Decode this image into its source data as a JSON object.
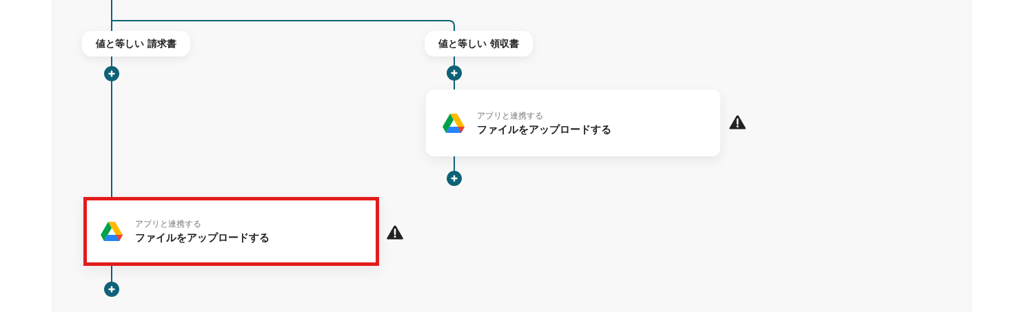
{
  "branches": [
    {
      "label": "値と等しい 請求書",
      "step": {
        "subtitle": "アプリと連携する",
        "title": "ファイルをアップロードする",
        "highlighted": true,
        "warning": true
      }
    },
    {
      "label": "値と等しい 領収書",
      "step": {
        "subtitle": "アプリと連携する",
        "title": "ファイルをアップロードする",
        "highlighted": false,
        "warning": true
      }
    }
  ]
}
